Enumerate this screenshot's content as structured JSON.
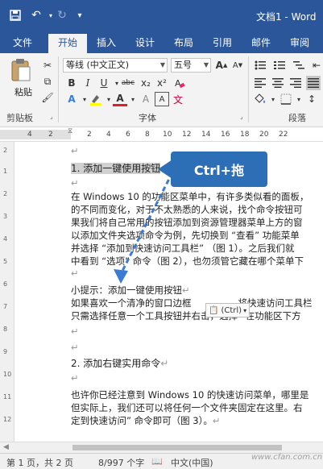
{
  "titlebar": {
    "doc_title": "文档1 - Word",
    "save_icon": "save-icon",
    "undo_icon": "undo-icon",
    "redo_icon": "redo-icon",
    "customize_icon": "customize-qa-icon"
  },
  "tabs": [
    {
      "label": "文件"
    },
    {
      "label": "开始"
    },
    {
      "label": "插入"
    },
    {
      "label": "设计"
    },
    {
      "label": "布局"
    },
    {
      "label": "引用"
    },
    {
      "label": "邮件"
    },
    {
      "label": "审阅"
    }
  ],
  "ribbon": {
    "paste_label": "粘贴",
    "clipboard_group": "剪贴板",
    "font_group": "字体",
    "paragraph_group": "段落",
    "font_name": "等线 (中文正文)",
    "font_size": "五号",
    "bold": "B",
    "italic": "I",
    "underline": "U",
    "strike": "abc",
    "subscript": "x₂",
    "superscript": "x²",
    "font_color_letter": "A",
    "text_effect_letter": "A"
  },
  "ruler": {
    "ticks": [
      "4",
      "2",
      "2",
      "4",
      "6",
      "8",
      "10",
      "12",
      "14",
      "16",
      "18",
      "20",
      "22"
    ]
  },
  "vruler": {
    "ticks": [
      "2",
      "1",
      "2",
      "3",
      "4",
      "5",
      "6",
      "7",
      "8",
      "9",
      "10",
      "11",
      "12"
    ]
  },
  "document": {
    "heading1": "1. 添加一键使用按钮",
    "p1_l1": "在 Windows 10 的功能区菜单中，有许多类似看的面板，",
    "p1_l2": "的不同而变化，对于不太熟悉的人来说，找个命令按钮可",
    "p1_l3": "果我们将自己常用的按钮添加到资源管理器菜单上方的窗",
    "p1_l4": "以添加文件夹选项命令为例，先切换到 “查看” 功能菜单",
    "p1_l5": "并选择 “添加到快速访问工具栏” （图 1）。之后我们就",
    "p1_l6": "中看到 “选项” 命令（图 2），也勿须管它藏在哪个菜单下",
    "tip_title": "小提示：添加一键使用按钮",
    "tip_l1": "如果喜欢一个清净的窗口边框",
    "tip_l1b": "将快速访问工具栏",
    "tip_l2": "只需选择任意一个工具按钮并右击，选择 “在功能区下方",
    "heading2": "2. 添加右键实用命令",
    "p2_l1": "也许你已经注意到 Windows 10 的快速访问菜单，哪里是",
    "p2_l2": "但实际上，我们还可以将任何一个文件夹固定在这里。右",
    "p2_l3": "定到快速访问” 命令即可（图 3）。",
    "para_mark": "↵"
  },
  "callout": {
    "text": "Ctrl+拖"
  },
  "paste_options": {
    "label": "(Ctrl)"
  },
  "status": {
    "page": "第 1 页，共 2 页",
    "words": "8/997 个字",
    "language": "中文(中国)"
  },
  "watermark": "www.cfan.com.cn",
  "colors": {
    "brand": "#2b579a",
    "callout": "#2d6fb7"
  }
}
